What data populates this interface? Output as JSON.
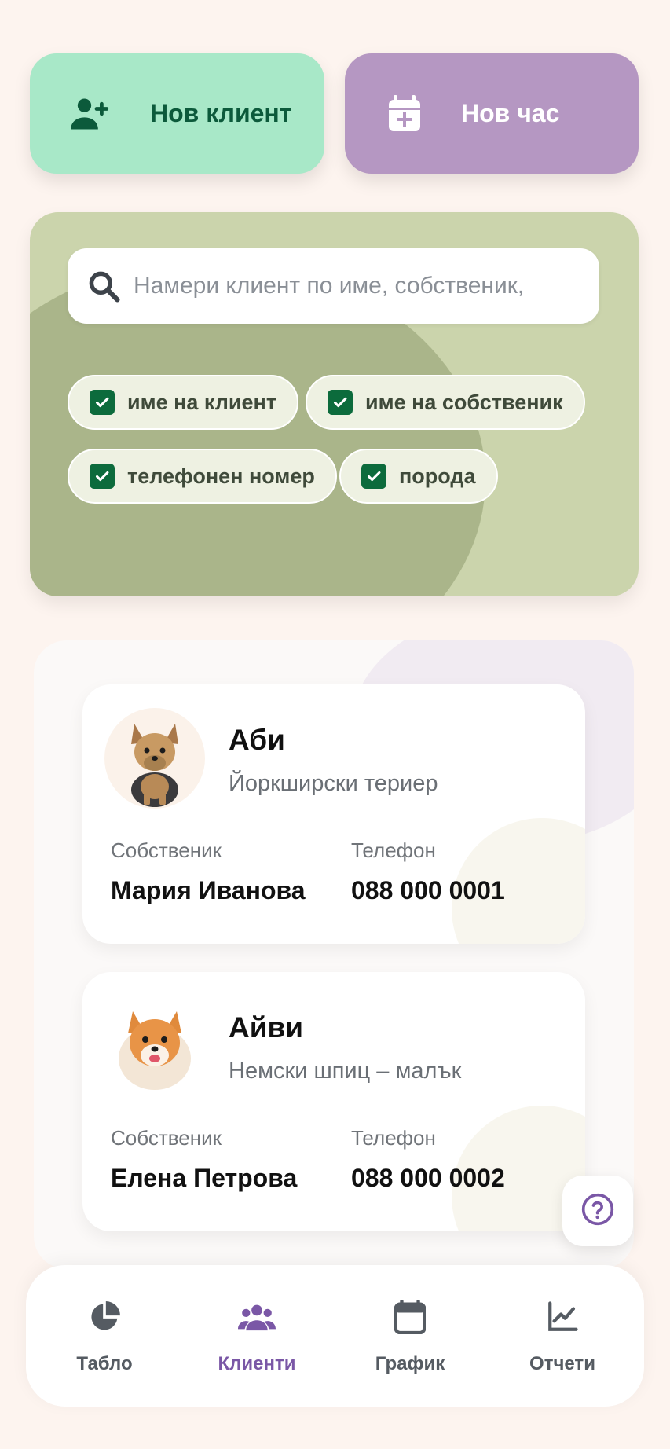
{
  "actions": {
    "new_client": "Нов клиент",
    "new_appointment": "Нов час"
  },
  "search": {
    "placeholder": "Намери клиент по име, собственик,",
    "value": "",
    "filters": [
      {
        "label": "име на клиент",
        "checked": true
      },
      {
        "label": "име на собственик",
        "checked": true
      },
      {
        "label": "телефонен номер",
        "checked": true
      },
      {
        "label": "порода",
        "checked": true
      }
    ]
  },
  "clients": [
    {
      "name": "Аби",
      "breed": "Йоркширски териер",
      "owner_label": "Собственик",
      "owner": "Мария Иванова",
      "phone_label": "Телефон",
      "phone": "088 000 0001",
      "avatar_icon": "yorkshire-terrier-avatar"
    },
    {
      "name": "Айви",
      "breed": "Немски шпиц – малък",
      "owner_label": "Собственик",
      "owner": "Елена Петрова",
      "phone_label": "Телефон",
      "phone": "088 000 0002",
      "avatar_icon": "pomeranian-avatar"
    }
  ],
  "nav": {
    "items": [
      {
        "label": "Табло",
        "icon": "pie-chart-icon",
        "active": false
      },
      {
        "label": "Клиенти",
        "icon": "users-icon",
        "active": true
      },
      {
        "label": "График",
        "icon": "calendar-icon",
        "active": false
      },
      {
        "label": "Отчети",
        "icon": "line-chart-icon",
        "active": false
      }
    ]
  },
  "colors": {
    "new_client_bg": "#a8e8c8",
    "new_appointment_bg": "#b597c2",
    "search_panel_bg": "#cbd4ac",
    "checkbox": "#0c6b3c",
    "accent": "#7a57a6"
  }
}
